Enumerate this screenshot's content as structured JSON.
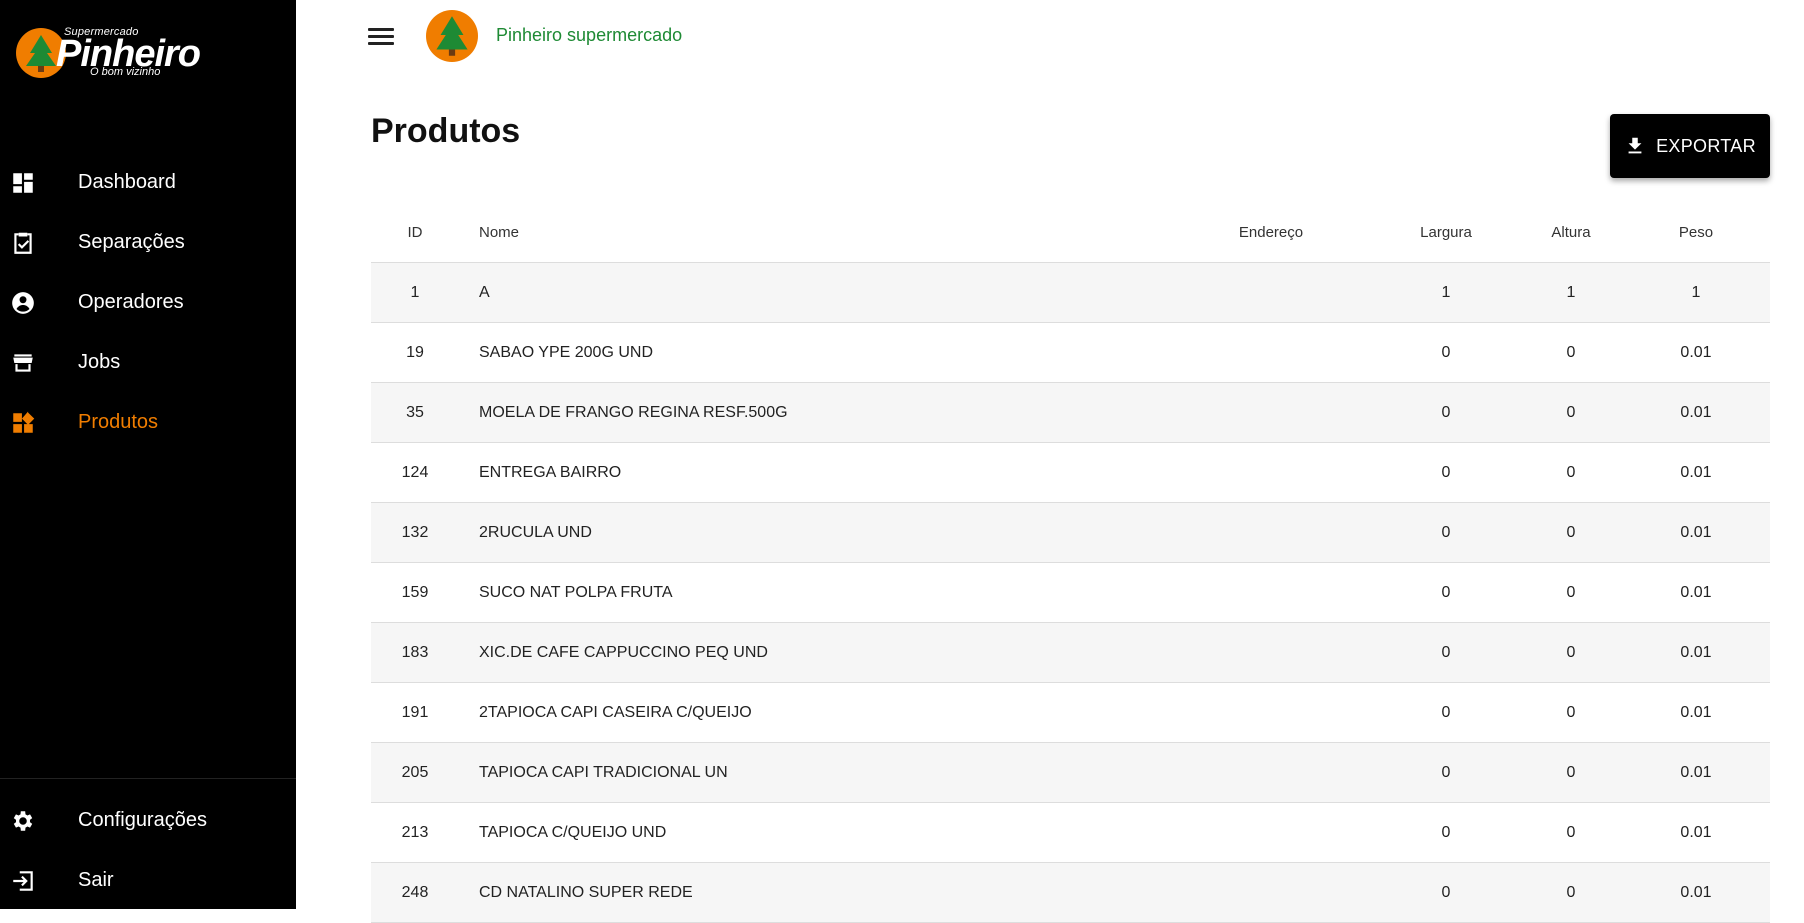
{
  "brand": {
    "top": "Supermercado",
    "name": "Pinheiro",
    "tagline": "O bom vizinho"
  },
  "sidebar": {
    "items": [
      {
        "label": "Dashboard",
        "icon": "dashboard-icon"
      },
      {
        "label": "Separações",
        "icon": "clipboard-check-icon"
      },
      {
        "label": "Operadores",
        "icon": "account-circle-icon"
      },
      {
        "label": "Jobs",
        "icon": "store-icon"
      },
      {
        "label": "Produtos",
        "icon": "widgets-icon",
        "active": true
      }
    ],
    "bottom": [
      {
        "label": "Configurações",
        "icon": "gear-icon"
      },
      {
        "label": "Sair",
        "icon": "logout-icon"
      }
    ]
  },
  "header": {
    "title": "Pinheiro supermercado"
  },
  "page": {
    "title": "Produtos",
    "export_label": "EXPORTAR"
  },
  "table": {
    "columns": [
      "ID",
      "Nome",
      "Endereço",
      "Largura",
      "Altura",
      "Peso"
    ],
    "rows": [
      {
        "id": "1",
        "nome": "A",
        "endereco": "",
        "largura": "1",
        "altura": "1",
        "peso": "1"
      },
      {
        "id": "19",
        "nome": "SABAO YPE 200G UND",
        "endereco": "",
        "largura": "0",
        "altura": "0",
        "peso": "0.01"
      },
      {
        "id": "35",
        "nome": "MOELA DE FRANGO REGINA RESF.500G",
        "endereco": "",
        "largura": "0",
        "altura": "0",
        "peso": "0.01"
      },
      {
        "id": "124",
        "nome": "ENTREGA BAIRRO",
        "endereco": "",
        "largura": "0",
        "altura": "0",
        "peso": "0.01"
      },
      {
        "id": "132",
        "nome": "2RUCULA UND",
        "endereco": "",
        "largura": "0",
        "altura": "0",
        "peso": "0.01"
      },
      {
        "id": "159",
        "nome": "SUCO NAT POLPA FRUTA",
        "endereco": "",
        "largura": "0",
        "altura": "0",
        "peso": "0.01"
      },
      {
        "id": "183",
        "nome": "XIC.DE CAFE CAPPUCCINO PEQ UND",
        "endereco": "",
        "largura": "0",
        "altura": "0",
        "peso": "0.01"
      },
      {
        "id": "191",
        "nome": "2TAPIOCA CAPI CASEIRA C/QUEIJO",
        "endereco": "",
        "largura": "0",
        "altura": "0",
        "peso": "0.01"
      },
      {
        "id": "205",
        "nome": "TAPIOCA CAPI TRADICIONAL UN",
        "endereco": "",
        "largura": "0",
        "altura": "0",
        "peso": "0.01"
      },
      {
        "id": "213",
        "nome": "TAPIOCA C/QUEIJO UND",
        "endereco": "",
        "largura": "0",
        "altura": "0",
        "peso": "0.01"
      },
      {
        "id": "248",
        "nome": "CD NATALINO SUPER REDE",
        "endereco": "",
        "largura": "0",
        "altura": "0",
        "peso": "0.01"
      }
    ]
  },
  "colors": {
    "accent": "#f07d00",
    "header_title": "#1e8a34",
    "sidebar_bg": "#000000"
  }
}
